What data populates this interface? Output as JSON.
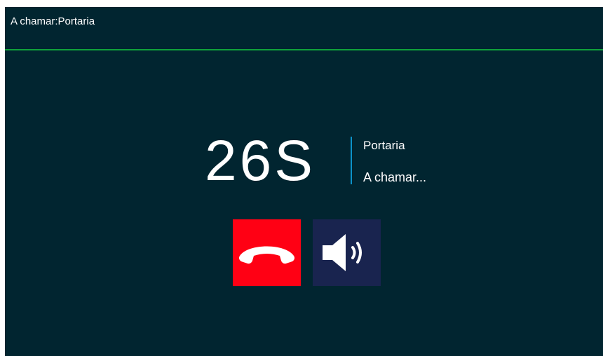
{
  "header": {
    "title": "A chamar:Portaria"
  },
  "call": {
    "timer": "26S",
    "callee": "Portaria",
    "status": "A chamar..."
  },
  "controls": {
    "hangup_icon": "hangup-phone-icon",
    "speaker_icon": "speaker-volume-icon"
  },
  "colors": {
    "background": "#012530",
    "divider": "#10a23a",
    "accent": "#0c93c9",
    "hangup": "#ff0014",
    "speaker": "#19244f"
  }
}
